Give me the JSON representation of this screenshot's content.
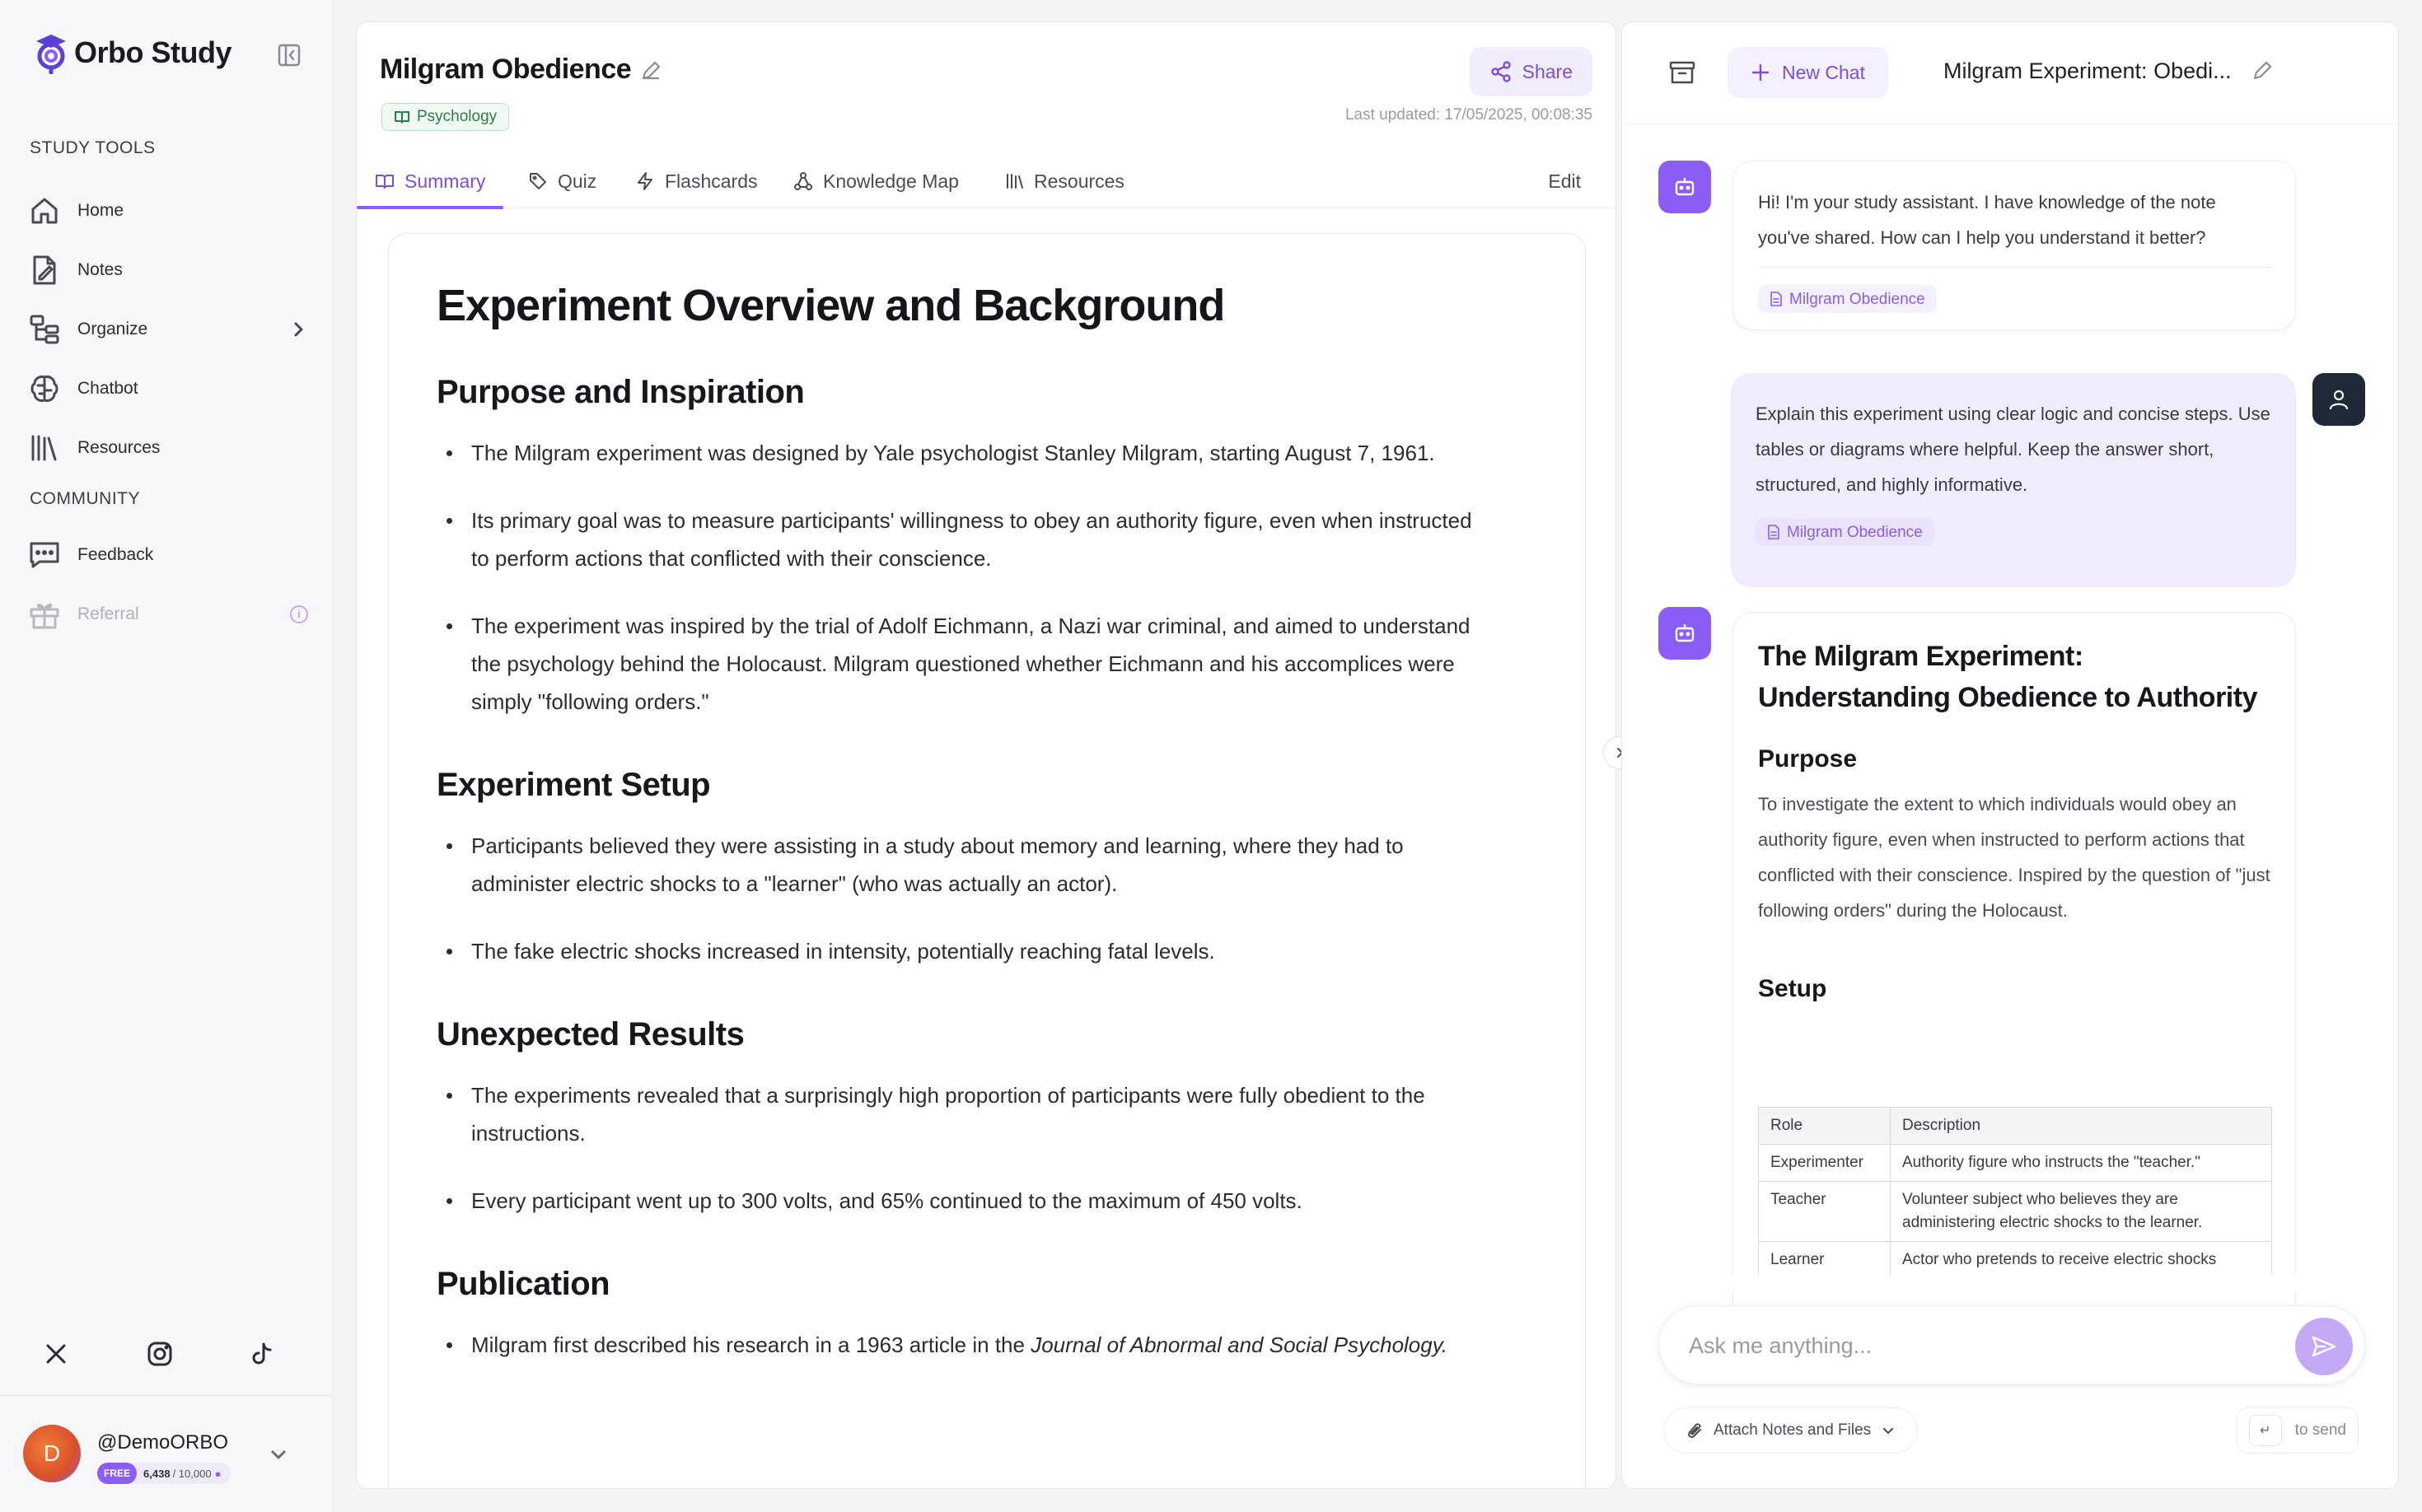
{
  "app": {
    "name": "Orbo Study"
  },
  "sidebar": {
    "study_tools_label": "STUDY TOOLS",
    "community_label": "COMMUNITY",
    "items": [
      {
        "label": "Home",
        "icon": "home-icon"
      },
      {
        "label": "Notes",
        "icon": "notes-icon"
      },
      {
        "label": "Organize",
        "icon": "organize-icon"
      },
      {
        "label": "Chatbot",
        "icon": "brain-icon"
      },
      {
        "label": "Resources",
        "icon": "library-icon"
      }
    ],
    "community_items": [
      {
        "label": "Feedback",
        "icon": "message-icon"
      },
      {
        "label": "Referral",
        "icon": "gift-icon"
      }
    ],
    "social": [
      "x-icon",
      "instagram-icon",
      "tiktok-icon"
    ],
    "profile": {
      "avatar_letter": "D",
      "username": "@DemoORBO",
      "plan": "FREE",
      "balance": "6,438",
      "limit": "/ 10,000"
    }
  },
  "note": {
    "title": "Milgram Obedience",
    "tag": "Psychology",
    "share_label": "Share",
    "last_updated": "Last updated: 17/05/2025, 00:08:35",
    "tabs": [
      "Summary",
      "Quiz",
      "Flashcards",
      "Knowledge Map",
      "Resources"
    ],
    "active_tab": "Summary",
    "edit_label": "Edit",
    "heading": "Experiment Overview and Background",
    "sections": [
      {
        "title": "Purpose and Inspiration",
        "bullets": [
          "The Milgram experiment was designed by Yale psychologist Stanley Milgram, starting August 7, 1961.",
          "Its primary goal was to measure participants' willingness to obey an authority figure, even when instructed to perform actions that conflicted with their conscience.",
          "The experiment was inspired by the trial of Adolf Eichmann, a Nazi war criminal, and aimed to understand the psychology behind the Holocaust. Milgram questioned whether Eichmann and his accomplices were simply \"following orders.\""
        ]
      },
      {
        "title": "Experiment Setup",
        "bullets": [
          "Participants believed they were assisting in a study about memory and learning, where they had to administer electric shocks to a \"learner\" (who was actually an actor).",
          "The fake electric shocks increased in intensity, potentially reaching fatal levels."
        ]
      },
      {
        "title": "Unexpected Results",
        "bullets": [
          "The experiments revealed that a surprisingly high proportion of participants were fully obedient to the instructions.",
          "Every participant went up to 300 volts, and 65% continued to the maximum of 450 volts."
        ]
      },
      {
        "title": "Publication",
        "bullet_prefix": "Milgram first described his research in a 1963 article in the ",
        "bullet_italic": "Journal of Abnormal and Social Psychology",
        "bullet_suffix": "."
      }
    ]
  },
  "chat": {
    "new_chat_label": "New Chat",
    "title": "Milgram Experiment: Obedi...",
    "messages": {
      "greeting": "Hi! I'm your study assistant. I have knowledge of the note you've shared. How can I help you understand it better?",
      "greeting_chip": "Milgram Obedience",
      "user_prompt": "Explain this experiment using clear logic and concise steps. Use tables or diagrams where helpful. Keep the answer short, structured, and highly informative.",
      "user_chip": "Milgram Obedience",
      "answer_title": "The Milgram Experiment: Understanding Obedience to Authority",
      "purpose_heading": "Purpose",
      "purpose_text": "To investigate the extent to which individuals would obey an authority figure, even when instructed to perform actions that conflicted with their conscience. Inspired by the question of \"just following orders\" during the Holocaust.",
      "setup_heading": "Setup",
      "table_headers": [
        "Role",
        "Description"
      ],
      "table_rows": [
        [
          "Experimenter",
          "Authority figure who instructs the \"teacher.\""
        ],
        [
          "Teacher",
          "Volunteer subject who believes they are administering electric shocks to the learner."
        ],
        [
          "Learner",
          "Actor who pretends to receive electric shocks"
        ]
      ]
    },
    "input_placeholder": "Ask me anything...",
    "attach_label": "Attach Notes and Files",
    "to_send_label": "to send",
    "enter_key": "↵"
  },
  "colors": {
    "accent": "#8b5cf6",
    "tag_green": "#2f7a4a"
  }
}
